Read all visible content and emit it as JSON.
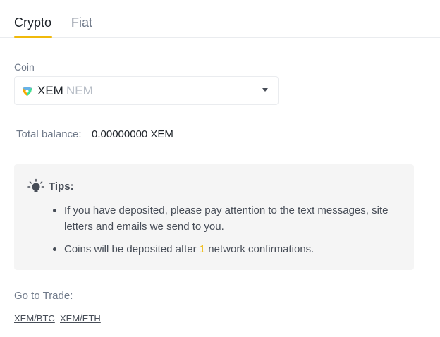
{
  "tabs": [
    {
      "label": "Crypto",
      "active": true
    },
    {
      "label": "Fiat",
      "active": false
    }
  ],
  "coin": {
    "label": "Coin",
    "symbol": "XEM",
    "name": "NEM",
    "icon": "nem-coin-icon"
  },
  "balance": {
    "label": "Total balance:",
    "value": "0.00000000 XEM"
  },
  "tips": {
    "title": "Tips:",
    "icon": "lightbulb-icon",
    "items": [
      {
        "text": "If you have deposited, please pay attention to the text messages, site letters and emails we send to you."
      },
      {
        "prefix": "Coins will be deposited after ",
        "highlight": "1",
        "suffix": " network confirmations."
      }
    ]
  },
  "trade": {
    "label": "Go to Trade:",
    "links": [
      "XEM/BTC",
      "XEM/ETH"
    ]
  },
  "colors": {
    "accent": "#f0b90b",
    "text_primary": "#1e2329",
    "text_secondary": "#707a8a",
    "tips_bg": "#f5f5f5"
  }
}
